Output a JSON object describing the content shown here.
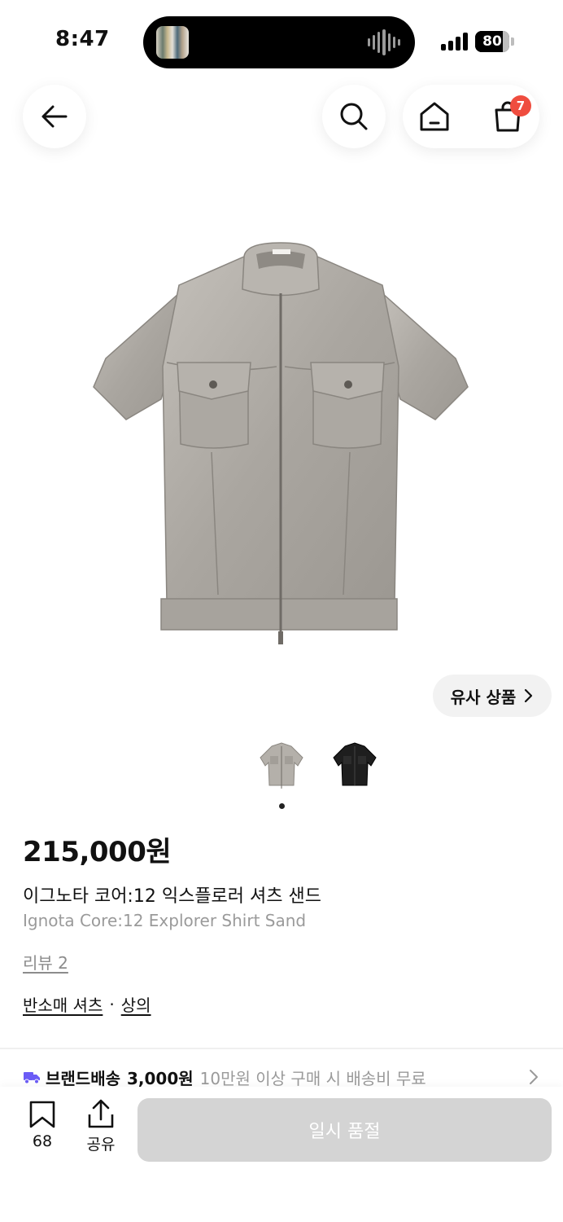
{
  "status_bar": {
    "time": "8:47",
    "battery": "80",
    "battery_level": 0.8
  },
  "nav": {
    "back_icon": "arrow-left-icon",
    "search_icon": "search-icon",
    "home_icon": "home-icon",
    "cart_icon": "shopping-bag-icon",
    "cart_badge": "7",
    "badge_color": "#ef4d3f"
  },
  "product": {
    "similar_label": "유사 상품",
    "price": "215,000원",
    "name_ko": "이그노타 코어:12 익스플로러 셔츠 샌드",
    "name_en": "Ignota Core:12 Explorer Shirt Sand",
    "review": "리뷰 2",
    "categories": [
      "반소매 셔츠",
      "상의"
    ],
    "category_separator": "·",
    "thumbnails": [
      "sand",
      "black"
    ]
  },
  "shipping": {
    "label": "브랜드배송",
    "fee": "3,000원",
    "note": "10만원 이상 구매 시 배송비 무료",
    "truck_color": "#6b5cf6"
  },
  "bottom_bar": {
    "bookmark_count": "68",
    "share_label": "공유",
    "soldout_label": "일시 품절"
  }
}
